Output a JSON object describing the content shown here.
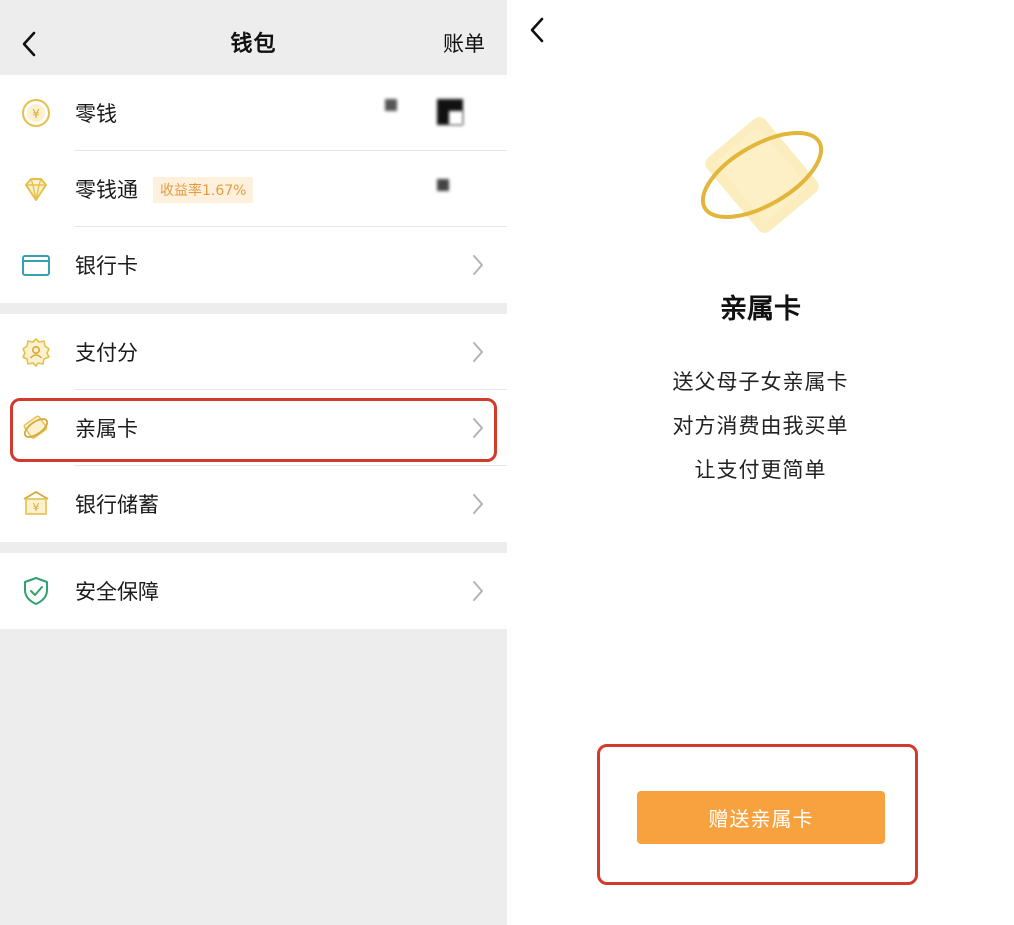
{
  "wallet": {
    "title": "钱包",
    "bill_link": "账单",
    "items": {
      "change": {
        "label": "零钱",
        "icon": "yuan-coin-icon"
      },
      "change_pass": {
        "label": "零钱通",
        "badge": "收益率1.67%",
        "icon": "diamond-icon"
      },
      "bank_card": {
        "label": "银行卡",
        "icon": "bank-card-icon"
      },
      "pay_score": {
        "label": "支付分",
        "icon": "pay-score-badge-icon"
      },
      "family_card": {
        "label": "亲属卡",
        "icon": "family-card-icon"
      },
      "bank_deposit": {
        "label": "银行储蓄",
        "icon": "bank-deposit-icon"
      },
      "security": {
        "label": "安全保障",
        "icon": "shield-check-icon"
      }
    }
  },
  "family_card_page": {
    "title": "亲属卡",
    "lines": [
      "送父母子女亲属卡",
      "对方消费由我买单",
      "让支付更简单"
    ],
    "button_label": "赠送亲属卡"
  },
  "colors": {
    "accent_orange": "#f7a23e",
    "icon_gold": "#e6c04a",
    "highlight_red": "#d23b2b",
    "icon_green": "#2fa36b",
    "icon_teal": "#3aa0b0",
    "background_gray": "#ededed"
  }
}
